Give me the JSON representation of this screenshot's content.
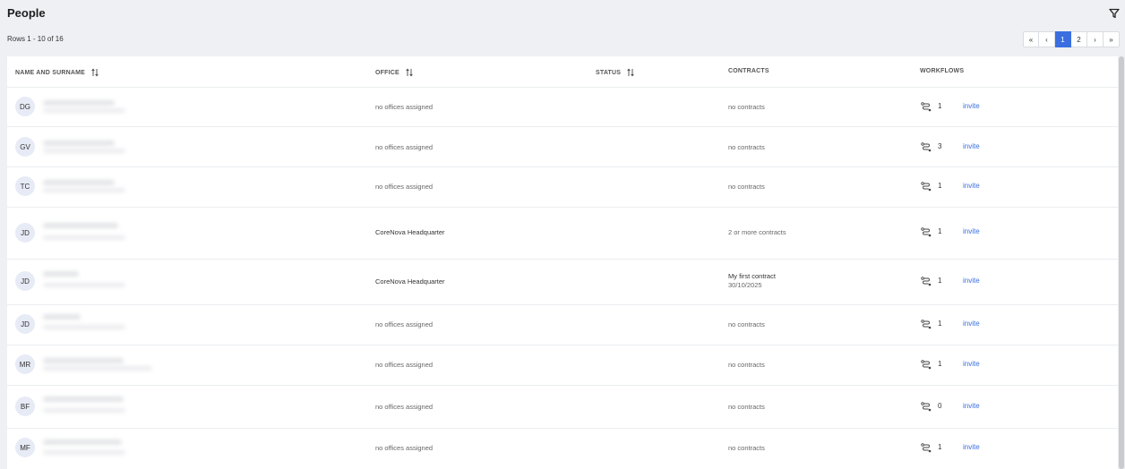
{
  "page": {
    "title": "People",
    "rows_summary": "Rows 1 - 10 of 16"
  },
  "pager": {
    "first": "«",
    "prev": "‹",
    "pages": [
      "1",
      "2"
    ],
    "current": "1",
    "next": "›",
    "last": "»"
  },
  "columns": {
    "name": "NAME AND SURNAME",
    "office": "OFFICE",
    "status": "STATUS",
    "contracts": "CONTRACTS",
    "workflows": "WORKFLOWS"
  },
  "icons": {
    "filter": "filter-icon",
    "sort": "sort-arrows-icon",
    "workflow": "workflow-icon"
  },
  "colors": {
    "accent": "#3b6fe0",
    "avatar_bg": "#e7ebf6",
    "page_bg": "#eef0f3"
  },
  "rows": [
    {
      "initials": "DG",
      "office": "no offices assigned",
      "contracts": "no contracts",
      "contract_date": "",
      "workflows": "1",
      "action": "invite"
    },
    {
      "initials": "GV",
      "office": "no offices assigned",
      "contracts": "no contracts",
      "contract_date": "",
      "workflows": "3",
      "action": "invite"
    },
    {
      "initials": "TC",
      "office": "no offices assigned",
      "contracts": "no contracts",
      "contract_date": "",
      "workflows": "1",
      "action": "invite"
    },
    {
      "initials": "JD",
      "office": "CoreNova Headquarter",
      "contracts": "2 or more contracts",
      "contract_date": "",
      "workflows": "1",
      "action": "invite"
    },
    {
      "initials": "JD",
      "office": "CoreNova Headquarter",
      "contracts": "My first contract",
      "contract_date": "30/10/2025",
      "workflows": "1",
      "action": "invite"
    },
    {
      "initials": "JD",
      "office": "no offices assigned",
      "contracts": "no contracts",
      "contract_date": "",
      "workflows": "1",
      "action": "invite"
    },
    {
      "initials": "MR",
      "office": "no offices assigned",
      "contracts": "no contracts",
      "contract_date": "",
      "workflows": "1",
      "action": "invite"
    },
    {
      "initials": "BF",
      "office": "no offices assigned",
      "contracts": "no contracts",
      "contract_date": "",
      "workflows": "0",
      "action": "invite"
    },
    {
      "initials": "MF",
      "office": "no offices assigned",
      "contracts": "no contracts",
      "contract_date": "",
      "workflows": "1",
      "action": "invite"
    }
  ]
}
